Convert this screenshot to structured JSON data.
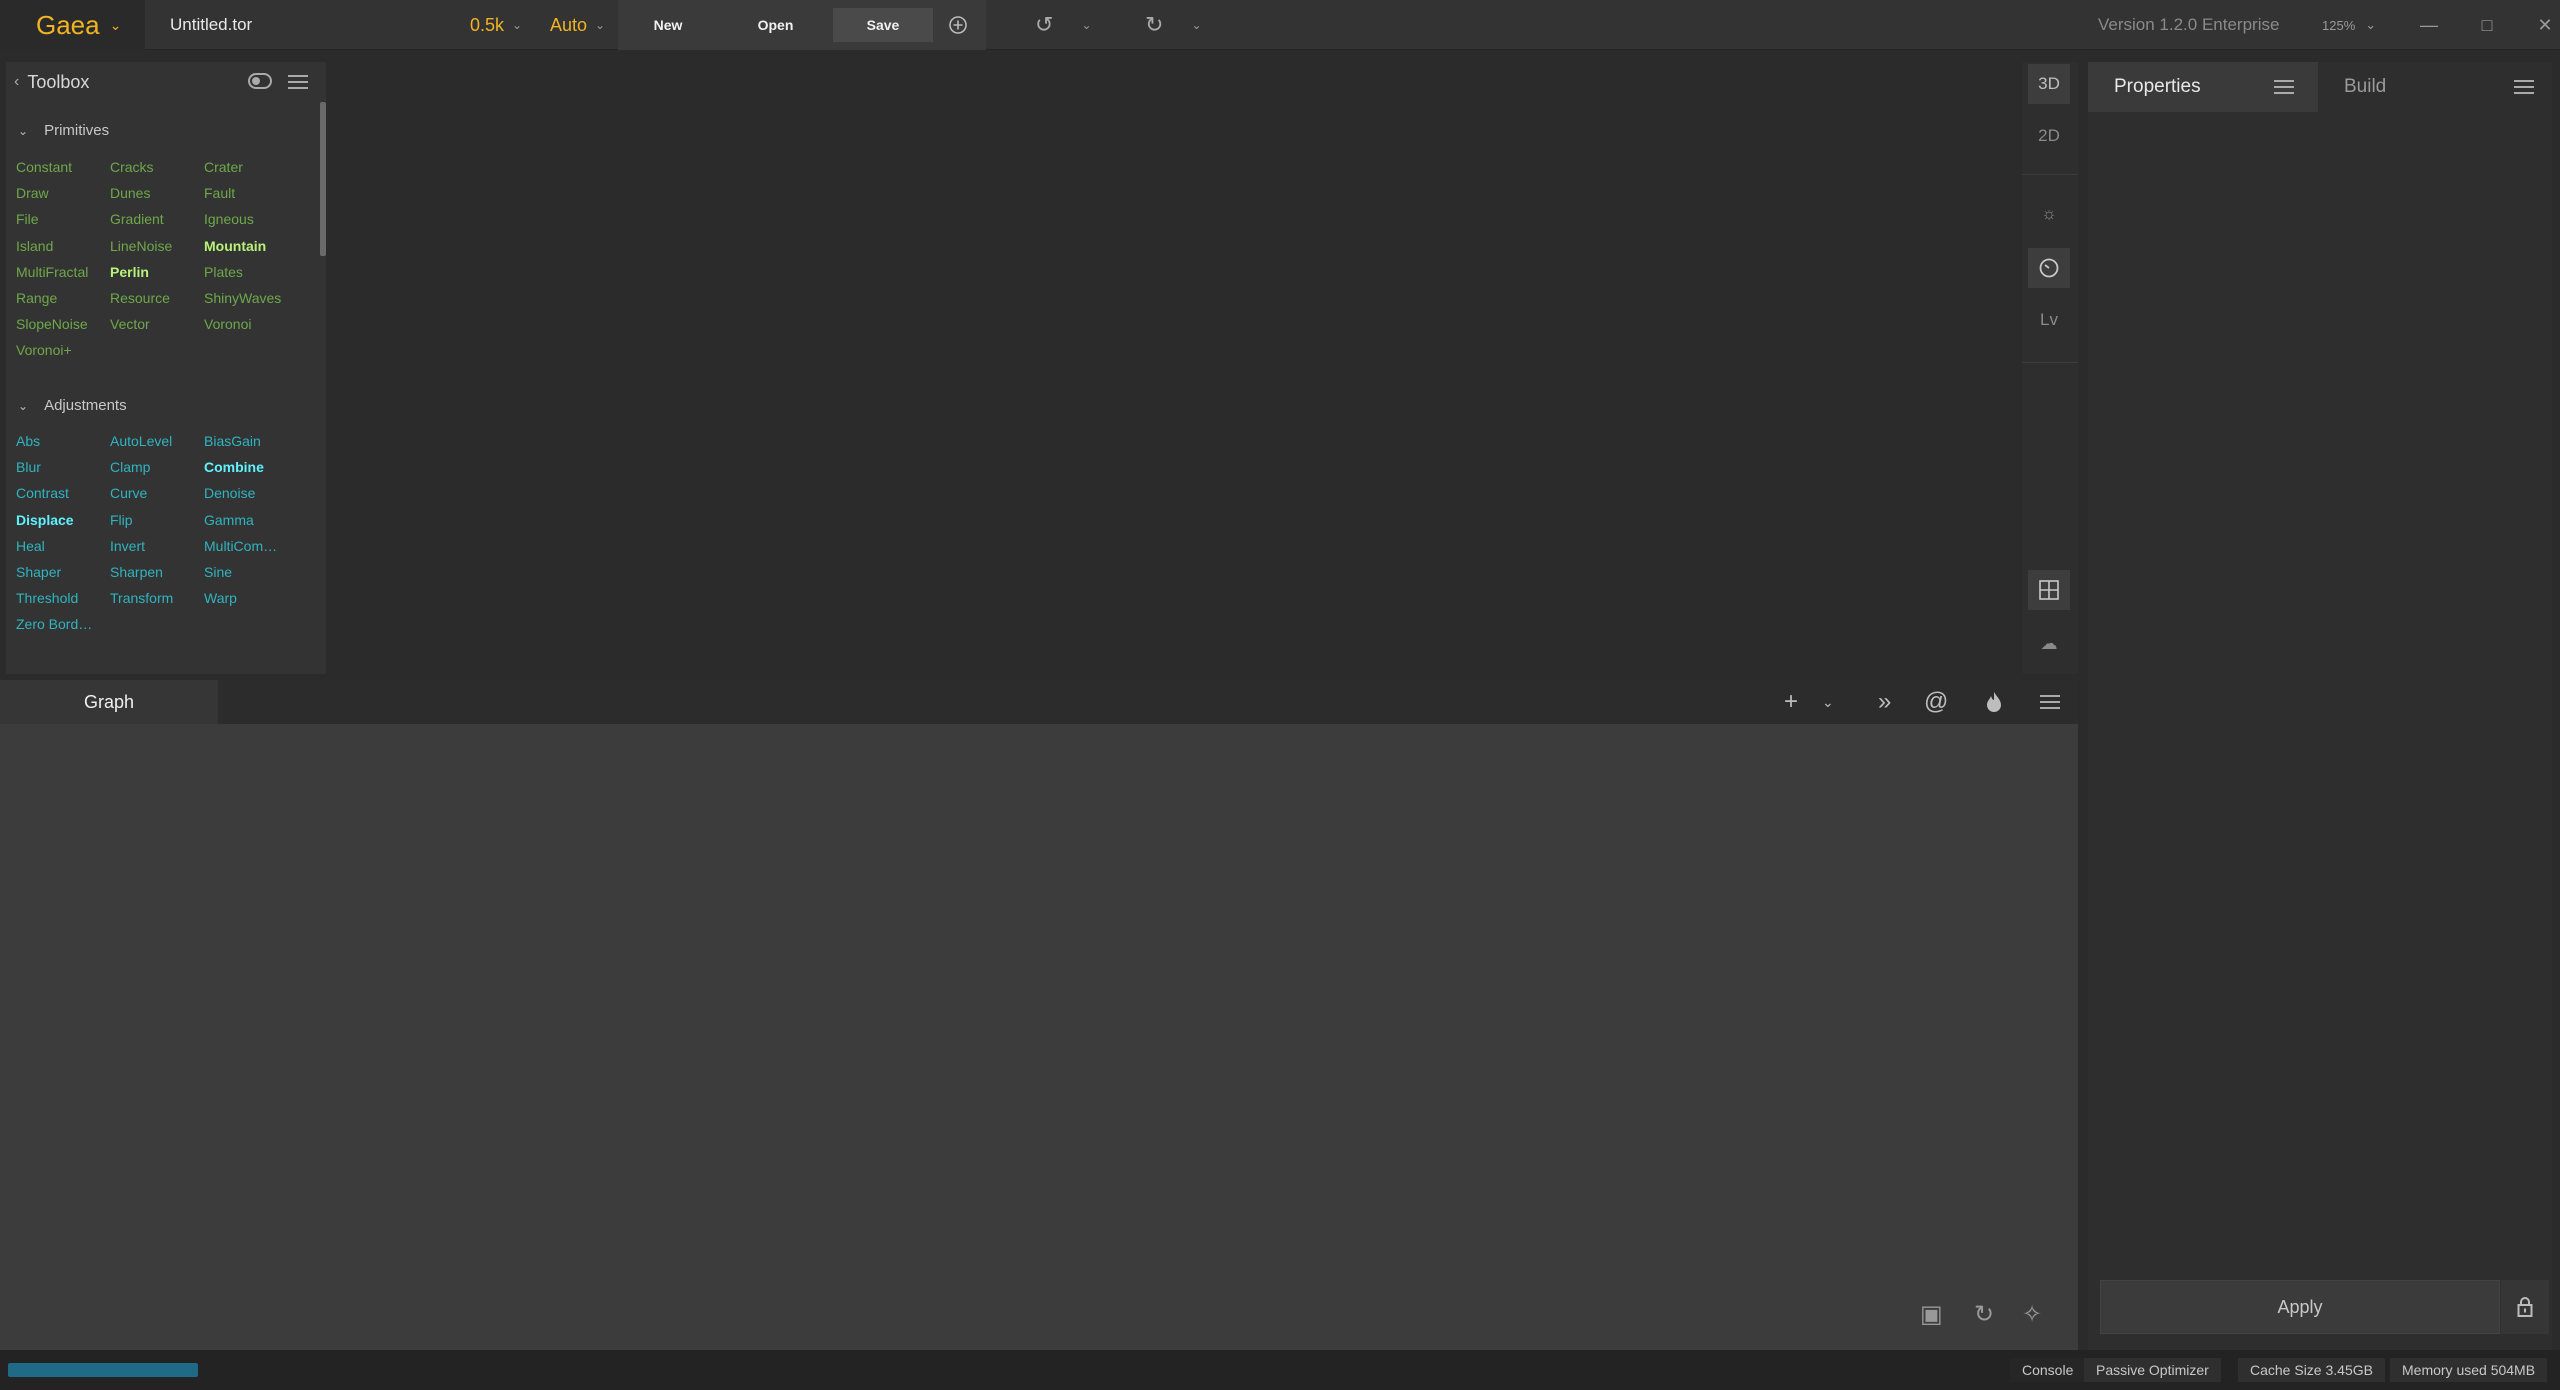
{
  "app": {
    "brand": "Gaea",
    "filename": "Untitled.tor",
    "resolution": "0.5k",
    "build_mode": "Auto",
    "version": "Version 1.2.0 Enterprise",
    "ui_zoom": "125%"
  },
  "toolbar": {
    "new_label": "New",
    "open_label": "Open",
    "save_label": "Save"
  },
  "toolbox": {
    "title": "Toolbox",
    "primitives": {
      "title": "Primitives",
      "items": [
        "Constant",
        "Cracks",
        "Crater",
        "Draw",
        "Dunes",
        "Fault",
        "File",
        "Gradient",
        "Igneous",
        "Island",
        "LineNoise",
        "Mountain",
        "MultiFractal",
        "Perlin",
        "Plates",
        "Range",
        "Resource",
        "ShinyWaves",
        "SlopeNoise",
        "Vector",
        "Voronoi",
        "Voronoi+"
      ],
      "highlighted": [
        "Mountain",
        "Perlin"
      ]
    },
    "adjustments": {
      "title": "Adjustments",
      "items": [
        "Abs",
        "AutoLevel",
        "BiasGain",
        "Blur",
        "Clamp",
        "Combine",
        "Contrast",
        "Curve",
        "Denoise",
        "Displace",
        "Flip",
        "Gamma",
        "Heal",
        "Invert",
        "MultiCom…",
        "Shaper",
        "Sharpen",
        "Sine",
        "Threshold",
        "Transform",
        "Warp",
        "Zero Bord…"
      ],
      "highlighted": [
        "Combine",
        "Displace"
      ]
    }
  },
  "viewport": {
    "btn_3d": "3D",
    "btn_2d": "2D",
    "btn_lv": "Lv"
  },
  "graph": {
    "tab_label": "Graph"
  },
  "properties": {
    "tab_label": "Properties",
    "build_tab_label": "Build",
    "apply_label": "Apply"
  },
  "status": {
    "console": "Console",
    "optimizer": "Passive Optimizer",
    "cache": "Cache Size 3.45GB",
    "memory": "Memory used 504MB"
  },
  "colors": {
    "accent": "#f0b323",
    "primitive": "#6ea84a",
    "primitive_highlight": "#b9f279",
    "adjustment": "#2fb4c0",
    "adjustment_highlight": "#5ff2ff",
    "progress": "#1f6a86"
  }
}
